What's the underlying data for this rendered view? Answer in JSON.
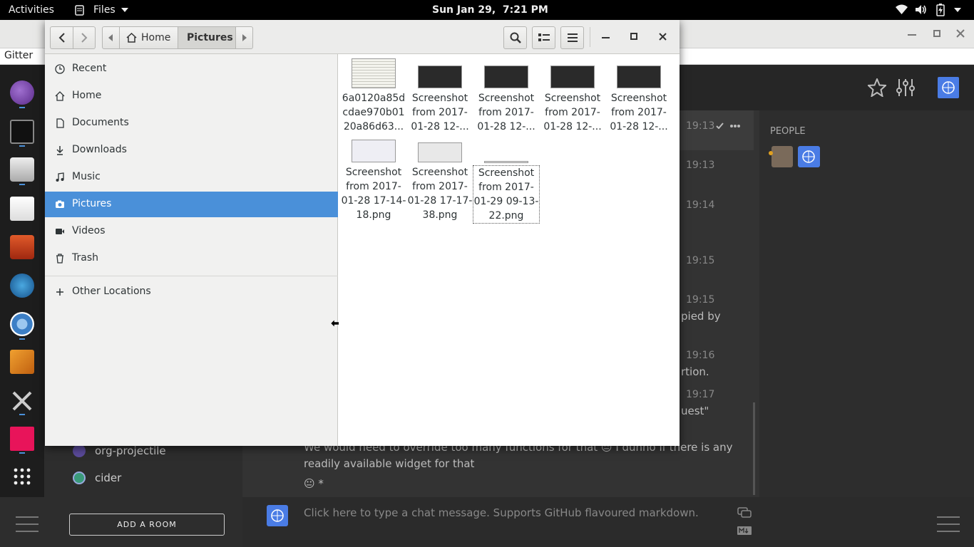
{
  "topbar": {
    "activities": "Activities",
    "app_menu": "Files",
    "clock": "Sun Jan 29,  7:21 PM"
  },
  "browser": {
    "tab_label": "Gitter"
  },
  "gitter": {
    "people_heading": "PEOPLE",
    "rooms": [
      {
        "label": "org-projectile"
      },
      {
        "label": "cider"
      }
    ],
    "add_room": "ADD A ROOM",
    "composer_placeholder": "Click here to type a chat message. Supports GitHub flavoured markdown.",
    "times": [
      "19:13",
      "19:13",
      "19:14",
      "19:15",
      "19:15",
      "19:16",
      "19:17"
    ],
    "fragments": [
      "pied by",
      "rtion.",
      "uest\""
    ],
    "message_line1": "We would need to override too many functions for that 😑 I dunno if there is any",
    "message_line2": "readily available widget for that",
    "message_line3": "😐 *"
  },
  "files": {
    "breadcrumb": [
      {
        "label": "Home"
      },
      {
        "label": "Pictures"
      }
    ],
    "sidebar": [
      {
        "label": "Recent",
        "icon": "clock-icon"
      },
      {
        "label": "Home",
        "icon": "home-icon"
      },
      {
        "label": "Documents",
        "icon": "document-icon"
      },
      {
        "label": "Downloads",
        "icon": "download-icon"
      },
      {
        "label": "Music",
        "icon": "music-icon"
      },
      {
        "label": "Pictures",
        "icon": "camera-icon",
        "selected": true
      },
      {
        "label": "Videos",
        "icon": "video-icon"
      },
      {
        "label": "Trash",
        "icon": "trash-icon"
      }
    ],
    "other_locations": "Other Locations",
    "items": [
      {
        "name": "6a0120a85d cdae970b01 20a86d63..."
      },
      {
        "name": "Screenshot from 2017-01-28 12-..."
      },
      {
        "name": "Screenshot from 2017-01-28 12-..."
      },
      {
        "name": "Screenshot from 2017-01-28 12-..."
      },
      {
        "name": "Screenshot from 2017-01-28 12-..."
      },
      {
        "name": "Screenshot from 2017-01-28 17-14-18.png"
      },
      {
        "name": "Screenshot from 2017-01-28 17-17-38.png"
      },
      {
        "name": "Screenshot from 2017-01-29 09-13-22.png",
        "selected": true
      }
    ]
  },
  "colors": {
    "accent": "#4a90d9",
    "gitter_blue": "#4a7ce5"
  }
}
